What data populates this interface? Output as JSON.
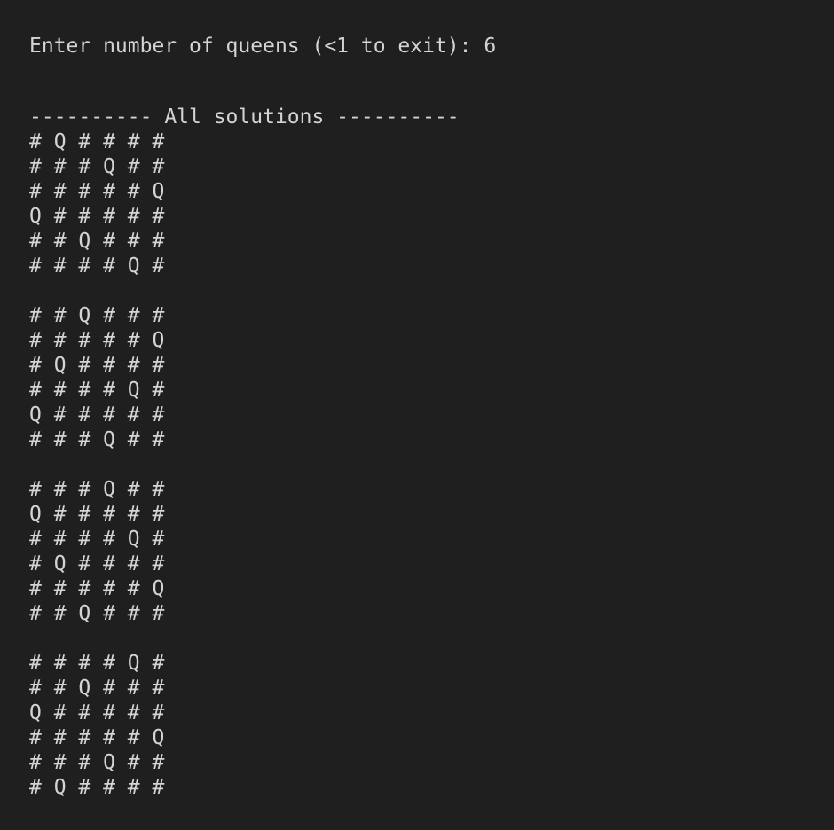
{
  "terminal": {
    "prompt": "Enter number of queens (<1 to exit): 6",
    "header": "---------- All solutions ----------",
    "solutions": [
      [
        "# Q # # # #",
        "# # # Q # #",
        "# # # # # Q",
        "Q # # # # #",
        "# # Q # # #",
        "# # # # Q #"
      ],
      [
        "# # Q # # #",
        "# # # # # Q",
        "# Q # # # #",
        "# # # # Q #",
        "Q # # # # #",
        "# # # Q # #"
      ],
      [
        "# # # Q # #",
        "Q # # # # #",
        "# # # # Q #",
        "# Q # # # #",
        "# # # # # Q",
        "# # Q # # #"
      ],
      [
        "# # # # Q #",
        "# # Q # # #",
        "Q # # # # #",
        "# # # # # Q",
        "# # # Q # #",
        "# Q # # # #"
      ]
    ]
  }
}
